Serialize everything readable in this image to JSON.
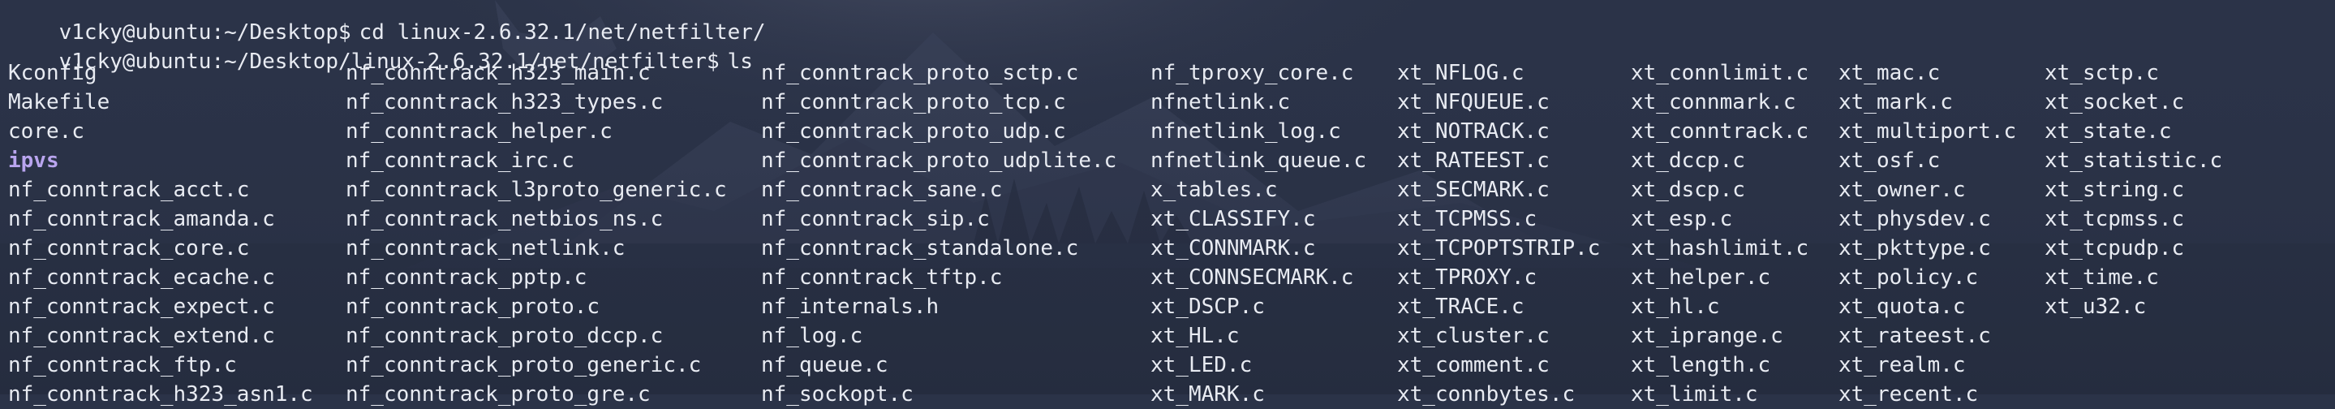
{
  "wallpaper_colors": {
    "background": "#2b3348",
    "mountain": "#3a4258",
    "mountain_dark": "#313850",
    "trees": "#262d40",
    "glow": "#4a5066"
  },
  "terminal": {
    "text_color": "#e8ebf2",
    "directory_color": "#b9a5ef",
    "prompts": [
      {
        "prompt": "v1cky@ubuntu:~/Desktop$",
        "command": "cd linux-2.6.32.1/net/netfilter/"
      },
      {
        "prompt": "v1cky@ubuntu:~/Desktop/linux-2.6.32.1/net/netfilter$",
        "command": "ls"
      }
    ],
    "listing": [
      [
        "Kconfig",
        "Makefile",
        "core.c",
        "ipvs",
        "nf_conntrack_acct.c",
        "nf_conntrack_amanda.c",
        "nf_conntrack_core.c",
        "nf_conntrack_ecache.c",
        "nf_conntrack_expect.c",
        "nf_conntrack_extend.c",
        "nf_conntrack_ftp.c",
        "nf_conntrack_h323_asn1.c"
      ],
      [
        "nf_conntrack_h323_main.c",
        "nf_conntrack_h323_types.c",
        "nf_conntrack_helper.c",
        "nf_conntrack_irc.c",
        "nf_conntrack_l3proto_generic.c",
        "nf_conntrack_netbios_ns.c",
        "nf_conntrack_netlink.c",
        "nf_conntrack_pptp.c",
        "nf_conntrack_proto.c",
        "nf_conntrack_proto_dccp.c",
        "nf_conntrack_proto_generic.c",
        "nf_conntrack_proto_gre.c"
      ],
      [
        "nf_conntrack_proto_sctp.c",
        "nf_conntrack_proto_tcp.c",
        "nf_conntrack_proto_udp.c",
        "nf_conntrack_proto_udplite.c",
        "nf_conntrack_sane.c",
        "nf_conntrack_sip.c",
        "nf_conntrack_standalone.c",
        "nf_conntrack_tftp.c",
        "nf_internals.h",
        "nf_log.c",
        "nf_queue.c",
        "nf_sockopt.c"
      ],
      [
        "nf_tproxy_core.c",
        "nfnetlink.c",
        "nfnetlink_log.c",
        "nfnetlink_queue.c",
        "x_tables.c",
        "xt_CLASSIFY.c",
        "xt_CONNMARK.c",
        "xt_CONNSECMARK.c",
        "xt_DSCP.c",
        "xt_HL.c",
        "xt_LED.c",
        "xt_MARK.c"
      ],
      [
        "xt_NFLOG.c",
        "xt_NFQUEUE.c",
        "xt_NOTRACK.c",
        "xt_RATEEST.c",
        "xt_SECMARK.c",
        "xt_TCPMSS.c",
        "xt_TCPOPTSTRIP.c",
        "xt_TPROXY.c",
        "xt_TRACE.c",
        "xt_cluster.c",
        "xt_comment.c",
        "xt_connbytes.c"
      ],
      [
        "xt_connlimit.c",
        "xt_connmark.c",
        "xt_conntrack.c",
        "xt_dccp.c",
        "xt_dscp.c",
        "xt_esp.c",
        "xt_hashlimit.c",
        "xt_helper.c",
        "xt_hl.c",
        "xt_iprange.c",
        "xt_length.c",
        "xt_limit.c"
      ],
      [
        "xt_mac.c",
        "xt_mark.c",
        "xt_multiport.c",
        "xt_osf.c",
        "xt_owner.c",
        "xt_physdev.c",
        "xt_pkttype.c",
        "xt_policy.c",
        "xt_quota.c",
        "xt_rateest.c",
        "xt_realm.c",
        "xt_recent.c"
      ],
      [
        "xt_sctp.c",
        "xt_socket.c",
        "xt_state.c",
        "xt_statistic.c",
        "xt_string.c",
        "xt_tcpmss.c",
        "xt_tcpudp.c",
        "xt_time.c",
        "xt_u32.c"
      ]
    ],
    "directories": [
      "ipvs"
    ]
  }
}
